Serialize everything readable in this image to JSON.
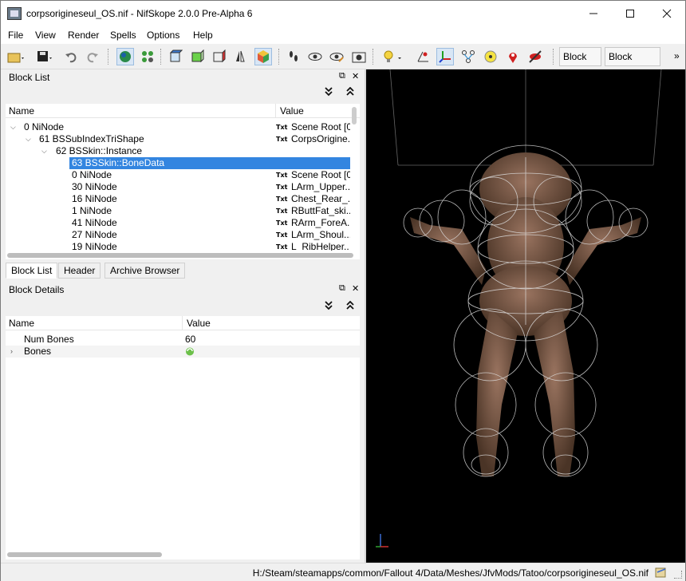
{
  "window": {
    "title": "corpsorigineseul_OS.nif - NifSkope 2.0.0 Pre-Alpha 6",
    "minimize_icon": "minimize-icon",
    "maximize_icon": "maximize-icon",
    "close_icon": "close-icon"
  },
  "menu": [
    "File",
    "View",
    "Render",
    "Spells",
    "Options",
    "Help"
  ],
  "toolbar": {
    "block_list_label": "Block List",
    "block_details_label": "Block Details",
    "overflow": "»"
  },
  "block_list": {
    "title": "Block List",
    "col_name": "Name",
    "col_value": "Value",
    "rows": [
      {
        "name": "0 NiNode",
        "value": "Scene Root [0",
        "txt": "Txt"
      },
      {
        "name": "61 BSSubIndexTriShape",
        "value": "CorpsOrigine...",
        "txt": "Txt"
      },
      {
        "name": "62 BSSkin::Instance",
        "value": "",
        "txt": ""
      },
      {
        "name": "63 BSSkin::BoneData",
        "value": "",
        "txt": ""
      },
      {
        "name": "0 NiNode",
        "value": "Scene Root [0",
        "txt": "Txt"
      },
      {
        "name": "30 NiNode",
        "value": "LArm_Upper...",
        "txt": "Txt"
      },
      {
        "name": "16 NiNode",
        "value": "Chest_Rear_...",
        "txt": "Txt"
      },
      {
        "name": "1 NiNode",
        "value": "RButtFat_ski...",
        "txt": "Txt"
      },
      {
        "name": "41 NiNode",
        "value": "RArm_ForeA...",
        "txt": "Txt"
      },
      {
        "name": "27 NiNode",
        "value": "LArm_Shoul...",
        "txt": "Txt"
      },
      {
        "name": "19 NiNode",
        "value": "L_RibHelper...",
        "txt": "Txt"
      }
    ]
  },
  "tabs": [
    "Block List",
    "Header",
    "Archive Browser"
  ],
  "block_details": {
    "title": "Block Details",
    "col_name": "Name",
    "col_value": "Value",
    "rows": [
      {
        "name": "Num Bones",
        "value": "60"
      },
      {
        "name": "Bones",
        "value": ""
      }
    ]
  },
  "status": {
    "path": "H:/Steam/steamapps/common/Fallout 4/Data/Meshes/JfvMods/Tatoo/corpsorigineseul_OS.nif"
  },
  "colors": {
    "selection": "#3385e0",
    "viewport_bg": "#000000",
    "skin": "#7a5a45"
  }
}
